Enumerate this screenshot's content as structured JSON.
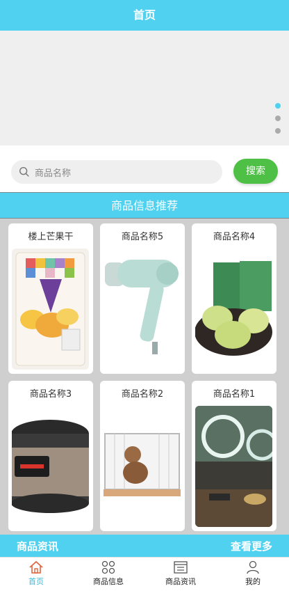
{
  "header": {
    "title": "首页"
  },
  "search": {
    "placeholder": "商品名称",
    "button": "搜索"
  },
  "section": {
    "title": "商品信息推荐"
  },
  "products": [
    {
      "name": "楼上芒果干",
      "image": "mango-snack-package"
    },
    {
      "name": "商品名称5",
      "image": "hair-dryer"
    },
    {
      "name": "商品名称4",
      "image": "green-pastries"
    },
    {
      "name": "商品名称3",
      "image": "rice-cooker"
    },
    {
      "name": "商品名称2",
      "image": "dog-in-cage"
    },
    {
      "name": "商品名称1",
      "image": "ring-light-desk"
    }
  ],
  "news": {
    "title": "商品资讯",
    "more": "查看更多"
  },
  "tabbar": [
    {
      "label": "首页",
      "icon": "home-icon",
      "active": true
    },
    {
      "label": "商品信息",
      "icon": "grid-icon",
      "active": false
    },
    {
      "label": "商品资讯",
      "icon": "news-icon",
      "active": false
    },
    {
      "label": "我的",
      "icon": "user-icon",
      "active": false
    }
  ],
  "colors": {
    "accent": "#4fd1ef",
    "search_button": "#4ec045",
    "active_tab": "#3fb7d6"
  }
}
